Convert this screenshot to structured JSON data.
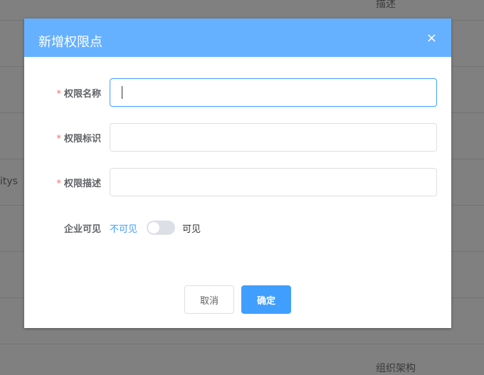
{
  "background": {
    "header_col": "描述",
    "row_text": "itys",
    "bottom_text": "组织架构"
  },
  "dialog": {
    "title": "新增权限点",
    "close_icon": "×",
    "fields": [
      {
        "label": "权限名称",
        "required": "*",
        "value": "",
        "placeholder": ""
      },
      {
        "label": "权限标识",
        "required": "*",
        "value": "",
        "placeholder": ""
      },
      {
        "label": "权限描述",
        "required": "*",
        "value": "",
        "placeholder": ""
      }
    ],
    "visibility": {
      "label": "企业可见",
      "off_text": "不可见",
      "on_text": "可见",
      "enabled": false
    },
    "cancel_label": "取消",
    "confirm_label": "确定"
  },
  "colors": {
    "accent": "#409eff",
    "header": "#66b1ff",
    "required": "#f56c6c"
  }
}
